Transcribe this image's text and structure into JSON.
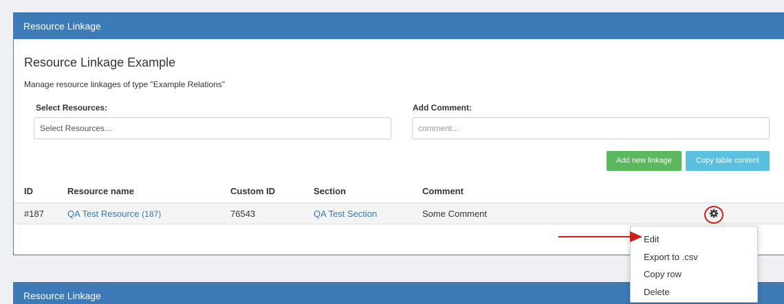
{
  "panel_1": {
    "heading": "Resource Linkage",
    "title": "Resource Linkage Example",
    "subtitle": "Manage resource linkages of type \"Example Relations\"",
    "select_resources": {
      "label": "Select Resources:",
      "placeholder": "Select Resources..."
    },
    "add_comment": {
      "label": "Add Comment:",
      "placeholder": "comment..."
    },
    "buttons": {
      "add_new_linkage": "Add new linkage",
      "copy_table_content": "Copy table content"
    },
    "table": {
      "columns": [
        "ID",
        "Resource name",
        "Custom ID",
        "Section",
        "Comment"
      ],
      "rows": [
        {
          "id": "#187",
          "resource_name": "QA Test Resource",
          "resource_id": "(187)",
          "custom_id": "76543",
          "section": "QA Test Section",
          "comment": "Some Comment"
        }
      ]
    },
    "row_menu": {
      "items": [
        "Edit",
        "Export to .csv",
        "Copy row",
        "Delete"
      ]
    }
  },
  "panel_2": {
    "heading": "Resource Linkage"
  },
  "colors": {
    "heading_blue": "#3d7ab8",
    "link_blue": "#337ab7",
    "success_green": "#5cb85c",
    "info_cyan": "#5bc0de",
    "annotation_red": "#d01b1b"
  },
  "icons": {
    "row_settings": "gear-icon",
    "annotation": "red-arrow-icon"
  }
}
